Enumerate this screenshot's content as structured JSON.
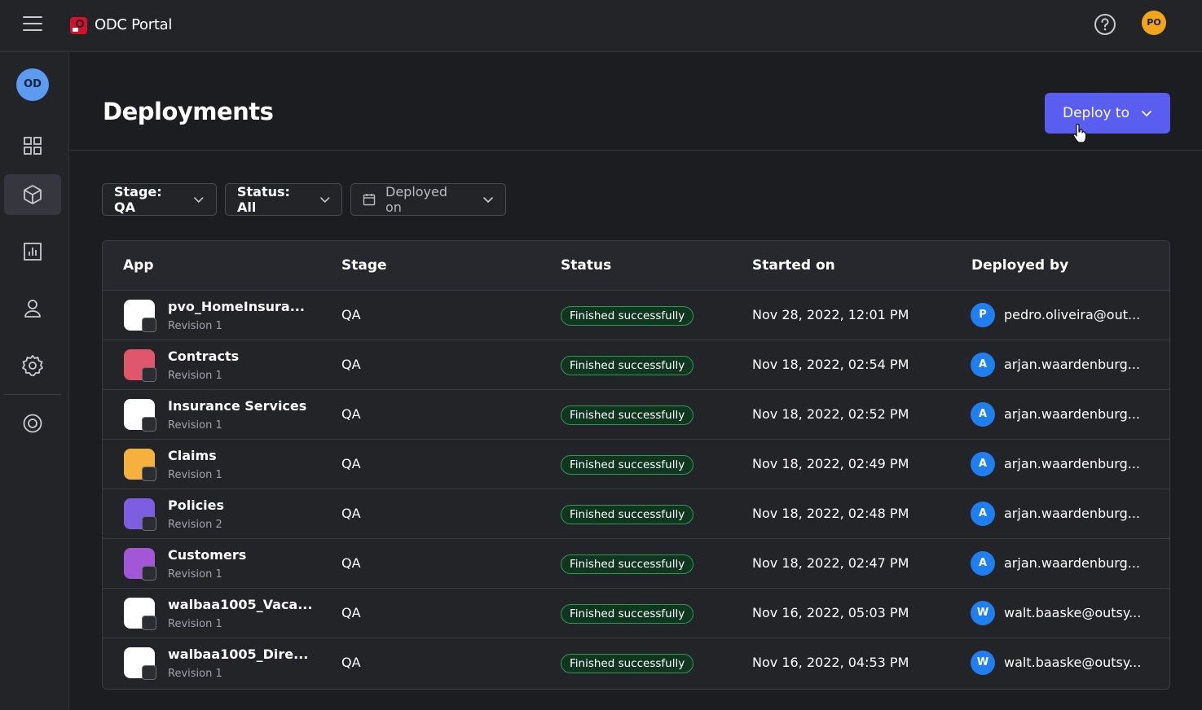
{
  "topbar": {
    "title": "ODC Portal",
    "user_initials": "PO"
  },
  "sidebar": {
    "org_initials": "OD",
    "items": [
      {
        "name": "dashboard",
        "icon": "grid-icon"
      },
      {
        "name": "apps",
        "icon": "cube-icon",
        "active": true
      },
      {
        "name": "analytics",
        "icon": "chart-icon"
      },
      {
        "name": "users",
        "icon": "user-icon"
      },
      {
        "name": "settings",
        "icon": "gear-icon"
      },
      {
        "name": "support",
        "icon": "lifebuoy-icon"
      }
    ]
  },
  "page": {
    "title": "Deployments",
    "deploy_button": "Deploy to"
  },
  "filters": {
    "stage": "Stage: QA",
    "status": "Status: All",
    "deployed_on": "Deployed on"
  },
  "table": {
    "columns": [
      "App",
      "Stage",
      "Status",
      "Started on",
      "Deployed by"
    ],
    "rows": [
      {
        "app": "pvo_HomeInsura...",
        "revision": "Revision 1",
        "stage": "QA",
        "status": "Finished successfully",
        "started": "Nov 28, 2022, 12:01 PM",
        "initial": "P",
        "email": "pedro.oliveira@out...",
        "icon_color": "#ffffff"
      },
      {
        "app": "Contracts",
        "revision": "Revision 1",
        "stage": "QA",
        "status": "Finished successfully",
        "started": "Nov 18, 2022, 02:54 PM",
        "initial": "A",
        "email": "arjan.waardenburg...",
        "icon_color": "#e0566d"
      },
      {
        "app": "Insurance Services",
        "revision": "Revision 1",
        "stage": "QA",
        "status": "Finished successfully",
        "started": "Nov 18, 2022, 02:52 PM",
        "initial": "A",
        "email": "arjan.waardenburg...",
        "icon_color": "#ffffff"
      },
      {
        "app": "Claims",
        "revision": "Revision 1",
        "stage": "QA",
        "status": "Finished successfully",
        "started": "Nov 18, 2022, 02:49 PM",
        "initial": "A",
        "email": "arjan.waardenburg...",
        "icon_color": "#f4b13c"
      },
      {
        "app": "Policies",
        "revision": "Revision 2",
        "stage": "QA",
        "status": "Finished successfully",
        "started": "Nov 18, 2022, 02:48 PM",
        "initial": "A",
        "email": "arjan.waardenburg...",
        "icon_color": "#7b5fe0"
      },
      {
        "app": "Customers",
        "revision": "Revision 1",
        "stage": "QA",
        "status": "Finished successfully",
        "started": "Nov 18, 2022, 02:47 PM",
        "initial": "A",
        "email": "arjan.waardenburg...",
        "icon_color": "#a157d6"
      },
      {
        "app": "walbaa1005_Vaca...",
        "revision": "Revision 1",
        "stage": "QA",
        "status": "Finished successfully",
        "started": "Nov 16, 2022, 05:03 PM",
        "initial": "W",
        "email": "walt.baaske@outsy...",
        "icon_color": "#ffffff"
      },
      {
        "app": "walbaa1005_Dire...",
        "revision": "Revision 1",
        "stage": "QA",
        "status": "Finished successfully",
        "started": "Nov 16, 2022, 04:53 PM",
        "initial": "W",
        "email": "walt.baaske@outsy...",
        "icon_color": "#ffffff"
      }
    ]
  }
}
